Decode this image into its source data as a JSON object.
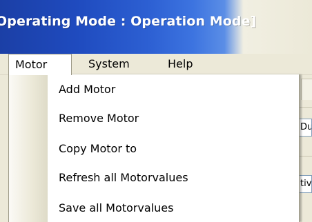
{
  "window": {
    "title": "Operating Mode : Operation Mode]",
    "title_colors": {
      "start": "#1b3fa6",
      "end": "#ece9d8"
    }
  },
  "menubar": {
    "items": [
      {
        "label": "Motor",
        "active": true
      },
      {
        "label": "System",
        "active": false
      },
      {
        "label": "Help",
        "active": false
      }
    ]
  },
  "dropdown": {
    "items": [
      {
        "label": "Add Motor"
      },
      {
        "label": "Remove Motor"
      },
      {
        "label": "Copy Motor to"
      },
      {
        "label": "Refresh all Motorvalues"
      },
      {
        "label": "Save all Motorvalues"
      }
    ]
  },
  "background": {
    "field_1_text": "Du",
    "field_2_text": "tiv"
  }
}
